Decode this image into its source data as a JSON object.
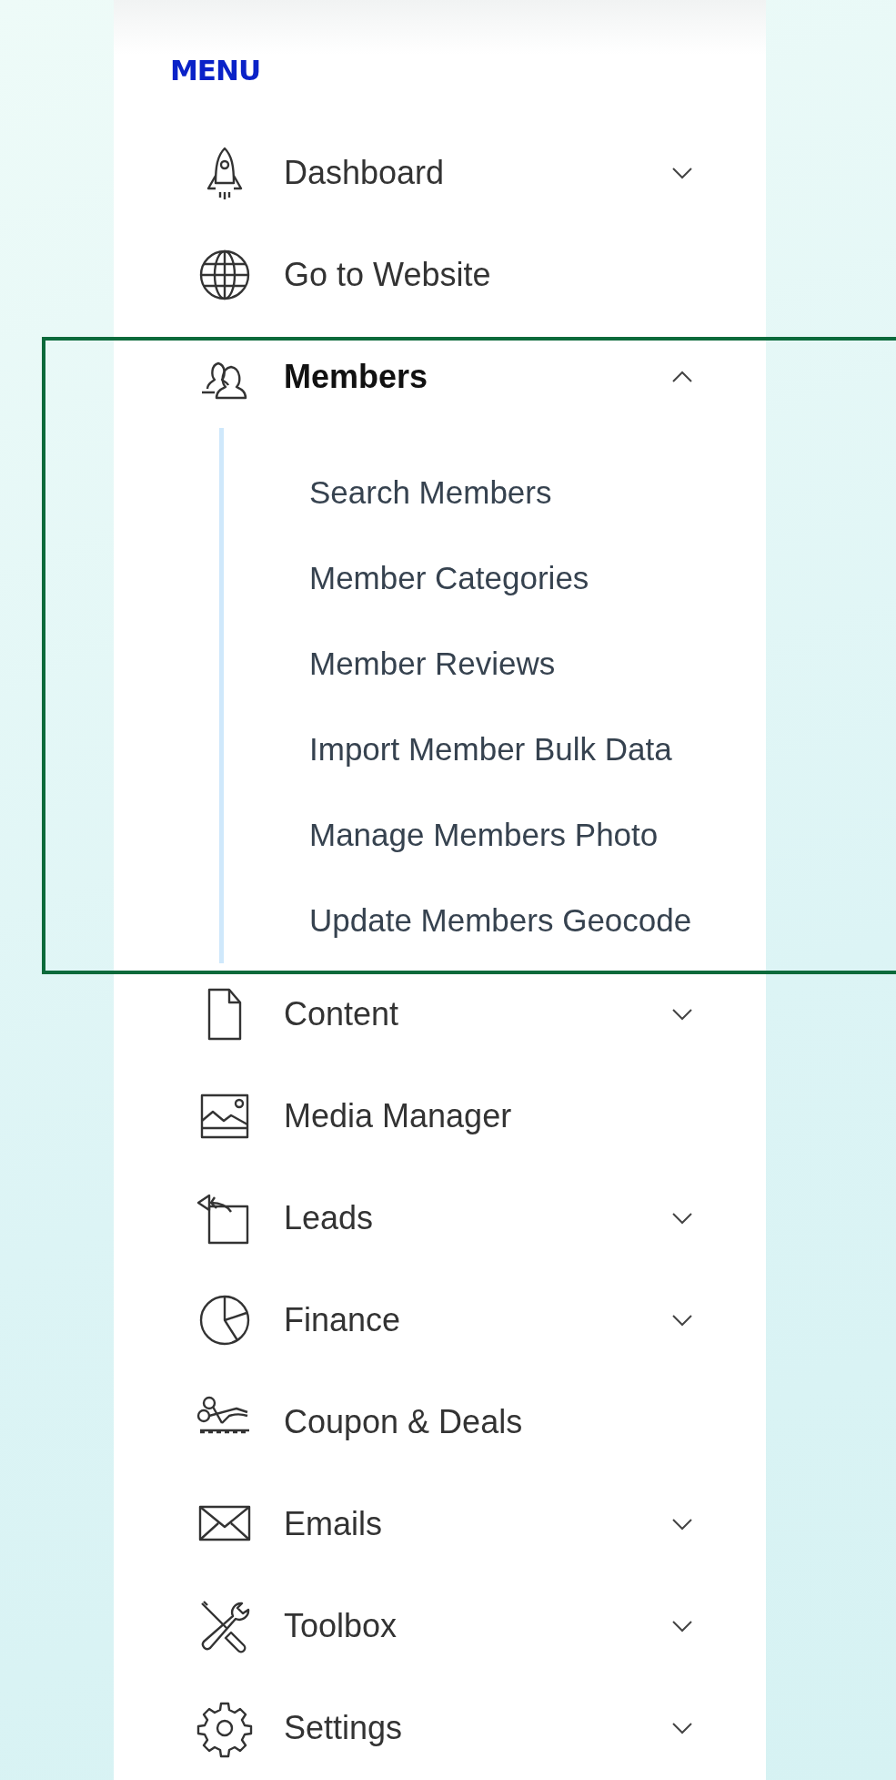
{
  "sidebar": {
    "heading": "MENU",
    "items": [
      {
        "label": "Dashboard",
        "kind": "group",
        "expanded": false,
        "selected": false
      },
      {
        "label": "Go to Website",
        "kind": "link",
        "selected": false
      },
      {
        "label": "Members",
        "kind": "group",
        "expanded": true,
        "selected": true,
        "children": [
          {
            "label": "Search Members"
          },
          {
            "label": "Member Categories"
          },
          {
            "label": "Member Reviews"
          },
          {
            "label": "Import Member Bulk Data"
          },
          {
            "label": "Manage Members Photo"
          },
          {
            "label": "Update Members Geocode"
          }
        ]
      },
      {
        "label": "Content",
        "kind": "group",
        "expanded": false,
        "selected": false
      },
      {
        "label": "Media Manager",
        "kind": "link",
        "selected": false
      },
      {
        "label": "Leads",
        "kind": "group",
        "expanded": false,
        "selected": false
      },
      {
        "label": "Finance",
        "kind": "group",
        "expanded": false,
        "selected": false
      },
      {
        "label": "Coupon & Deals",
        "kind": "link",
        "selected": false
      },
      {
        "label": "Emails",
        "kind": "group",
        "expanded": false,
        "selected": false
      },
      {
        "label": "Toolbox",
        "kind": "group",
        "expanded": false,
        "selected": false
      },
      {
        "label": "Settings",
        "kind": "group",
        "expanded": false,
        "selected": false
      }
    ]
  }
}
